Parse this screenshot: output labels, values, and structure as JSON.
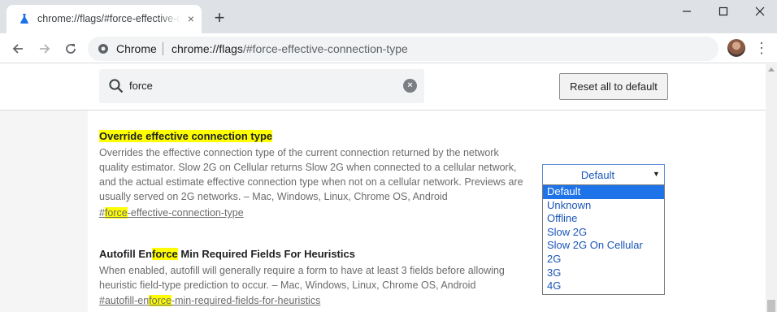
{
  "tab": {
    "title": "chrome://flags/#force-effective-connection-type",
    "favicon": "flask-icon",
    "close": "×"
  },
  "newtab": "+",
  "window_controls": {
    "minimize": "—",
    "maximize": "☐",
    "close": "✕"
  },
  "toolbar": {
    "back": "←",
    "forward": "→",
    "reload": "↻",
    "star": "☆",
    "menu": "⋮"
  },
  "omnibox": {
    "site_label": "Chrome",
    "url_host": "chrome://flags",
    "url_rest": "/#force-effective-connection-type"
  },
  "search": {
    "value": "force",
    "clear": "×"
  },
  "reset_button": "Reset all to default",
  "experiments": [
    {
      "title_pre": "",
      "title_hl": "Override effective connection type",
      "title_post": "",
      "description": "Overrides the effective connection type of the current connection returned by the network quality estimator. Slow 2G on Cellular returns Slow 2G when connected to a cellular network, and the actual estimate effective connection type when not on a cellular network. Previews are usually served on 2G networks. – Mac, Windows, Linux, Chrome OS, Android",
      "link_pre": "#",
      "link_hl": "force",
      "link_post": "-effective-connection-type",
      "select": {
        "value": "Default",
        "options": [
          "Default",
          "Unknown",
          "Offline",
          "Slow 2G",
          "Slow 2G On Cellular",
          "2G",
          "3G",
          "4G"
        ],
        "selected_index": 0
      }
    },
    {
      "title_pre": "Autofill En",
      "title_hl": "force",
      "title_post": " Min Required Fields For Heuristics",
      "description": "When enabled, autofill will generally require a form to have at least 3 fields before allowing heuristic field-type prediction to occur. – Mac, Windows, Linux, Chrome OS, Android",
      "link_pre": "#autofill-en",
      "link_hl": "force",
      "link_post": "-min-required-fields-for-heuristics"
    }
  ],
  "colors": {
    "highlight": "#ffff00",
    "accent": "#1e73e8",
    "dropdown_text": "#1a56b8"
  }
}
